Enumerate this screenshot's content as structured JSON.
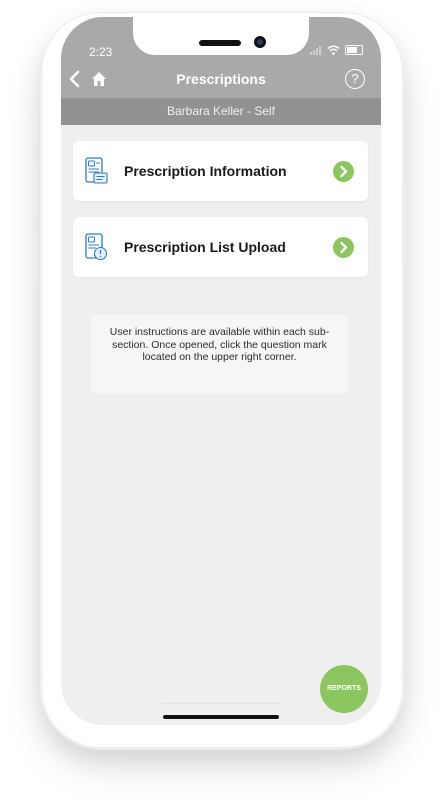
{
  "status_bar": {
    "time": "2:23"
  },
  "nav": {
    "title": "Prescriptions",
    "help_label": "?",
    "back_icon": "chevron-left-icon",
    "home_icon": "home-icon"
  },
  "subheader": {
    "text": "Barbara Keller - Self"
  },
  "menu": [
    {
      "label": "Prescription Information",
      "icon": "prescription-info-icon"
    },
    {
      "label": "Prescription List Upload",
      "icon": "prescription-upload-icon"
    }
  ],
  "info": {
    "text": "User instructions are available within each sub-section. Once opened, click the question mark located on the upper right corner."
  },
  "fab": {
    "label": "REPORTS"
  },
  "colors": {
    "header_gray": "#a9a9a9",
    "subheader_gray": "#929292",
    "accent_green": "#8bc65e",
    "icon_blue": "#2e7bc4",
    "background": "#efefef"
  }
}
